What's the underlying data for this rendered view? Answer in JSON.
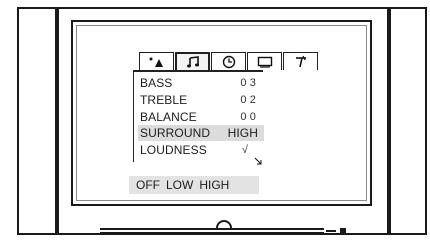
{
  "osd": {
    "tabs": [
      {
        "icon": "picture-icon",
        "active": false
      },
      {
        "icon": "music-note-icon",
        "active": true
      },
      {
        "icon": "clock-icon",
        "active": false
      },
      {
        "icon": "screen-icon",
        "active": false
      },
      {
        "icon": "antenna-icon",
        "active": false
      }
    ],
    "menu_items": [
      {
        "label": "BASS",
        "value": "0 3"
      },
      {
        "label": "TREBLE",
        "value": "0 2"
      },
      {
        "label": "BALANCE",
        "value": "0 0"
      },
      {
        "label": "SURROUND",
        "value": "HIGH",
        "selected": true
      },
      {
        "label": "LOUDNESS",
        "value": "√"
      }
    ],
    "options": [
      "OFF",
      "LOW",
      "HIGH"
    ]
  }
}
